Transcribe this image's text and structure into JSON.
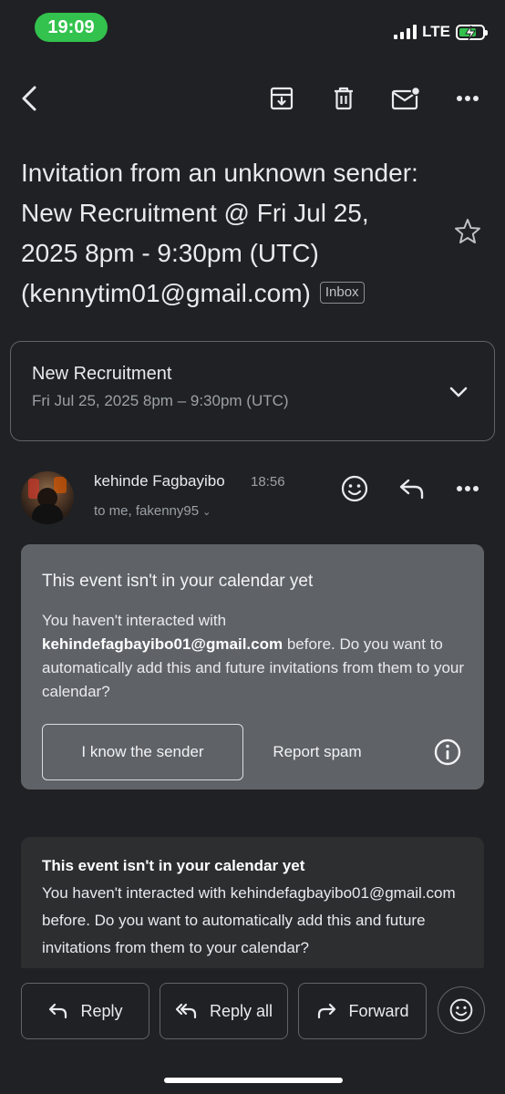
{
  "status_bar": {
    "time": "19:09",
    "network": "LTE",
    "time_bg_color": "#32c24d"
  },
  "toolbar": {
    "icons": [
      "back-arrow-icon",
      "archive-icon",
      "trash-icon",
      "mark-unread-icon",
      "more-vert-icon"
    ]
  },
  "subject": {
    "text": "Invitation from an unknown sender: New Recruitment @ Fri Jul 25, 2025 8pm - 9:30pm (UTC) (kennytim01@gmail.com)",
    "label_chip": "Inbox"
  },
  "event_card": {
    "title": "New Recruitment",
    "time": "Fri Jul 25, 2025 8pm – 9:30pm (UTC)"
  },
  "message": {
    "sender_name": "kehinde Fagbayibo",
    "time": "18:56",
    "recipients": "to me, fakenny95"
  },
  "calendar_notice": {
    "title": "This event isn't in your calendar yet",
    "body_prefix": "You haven't interacted with",
    "email": "kehindefagbayibo01@gmail.com",
    "body_suffix": "before. Do you want to automatically add this and future invitations from them to your calendar?",
    "know_sender_label": "I know the sender",
    "report_spam_label": "Report spam"
  },
  "body_preview": {
    "title": "This event isn't in your calendar yet",
    "text": "You haven't interacted with kehindefagbayibo01@gmail.com before. Do you want to automatically add this and future invitations from them to your calendar?"
  },
  "actions": {
    "reply_label": "Reply",
    "reply_all_label": "Reply all",
    "forward_label": "Forward"
  },
  "colors": {
    "background": "#202124",
    "notice_bg": "#5f6368",
    "body_bg": "#2d2e30",
    "text_primary": "#e8eaed",
    "text_secondary": "#9aa0a6"
  }
}
